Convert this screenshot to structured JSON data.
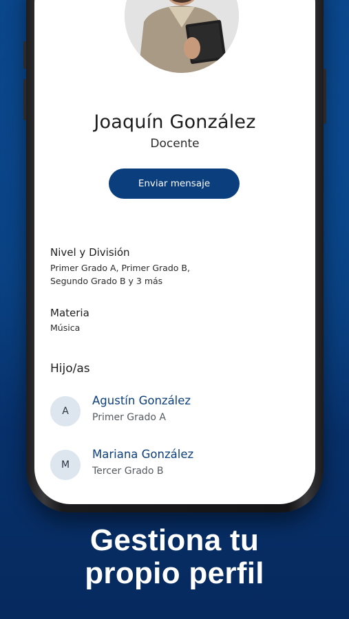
{
  "profile": {
    "name": "Joaquín González",
    "role": "Docente",
    "send_message_label": "Enviar mensaje"
  },
  "details": {
    "level_label": "Nivel y División",
    "level_value_line1": "Primer Grado A, Primer Grado B,",
    "level_value_line2": "Segundo Grado B y 3 más",
    "subject_label": "Materia",
    "subject_value": "Música"
  },
  "children": {
    "title": "Hijo/as",
    "items": [
      {
        "initial": "A",
        "name": "Agustín González",
        "grade": "Primer Grado A"
      },
      {
        "initial": "M",
        "name": "Mariana González",
        "grade": "Tercer Grado B"
      }
    ]
  },
  "promo": {
    "headline_line1": "Gestiona tu",
    "headline_line2": "propio perfil"
  },
  "colors": {
    "brand_blue": "#0b3e7d",
    "background_blue": "#093c7a",
    "child_avatar_bg": "#dde5ef"
  },
  "icons": {
    "profile_photo": "teacher-portrait-photo"
  }
}
